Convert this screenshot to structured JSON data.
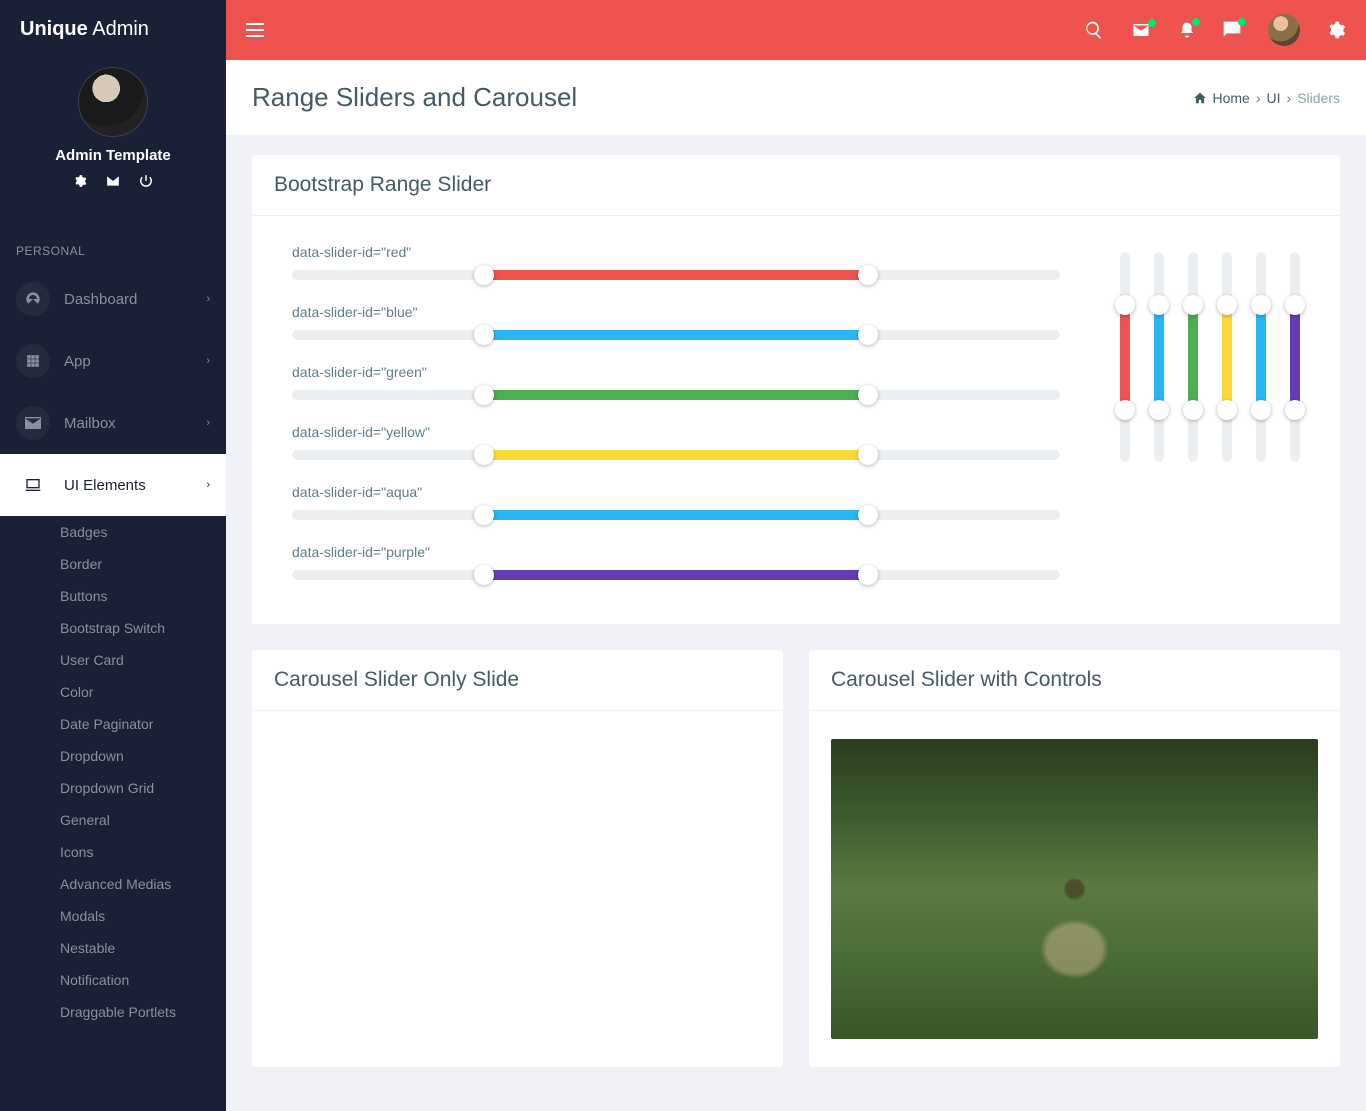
{
  "brand": {
    "bold": "Unique",
    "light": "Admin"
  },
  "user": {
    "name": "Admin Template"
  },
  "sidebar": {
    "section": "PERSONAL",
    "items": [
      {
        "label": "Dashboard",
        "icon": "dashboard-icon"
      },
      {
        "label": "App",
        "icon": "grid-icon"
      },
      {
        "label": "Mailbox",
        "icon": "mail-icon"
      },
      {
        "label": "UI Elements",
        "icon": "laptop-icon",
        "active": true
      }
    ],
    "subitems": [
      "Badges",
      "Border",
      "Buttons",
      "Bootstrap Switch",
      "User Card",
      "Color",
      "Date Paginator",
      "Dropdown",
      "Dropdown Grid",
      "General",
      "Icons",
      "Advanced Medias",
      "Modals",
      "Nestable",
      "Notification",
      "Draggable Portlets"
    ]
  },
  "page": {
    "title": "Range Sliders and Carousel",
    "breadcrumb": {
      "home": "Home",
      "mid": "UI",
      "current": "Sliders"
    }
  },
  "panels": {
    "range": {
      "title": "Bootstrap Range Slider",
      "sliders": [
        {
          "label": "data-slider-id=\"red\"",
          "color": "c-red"
        },
        {
          "label": "data-slider-id=\"blue\"",
          "color": "c-blue"
        },
        {
          "label": "data-slider-id=\"green\"",
          "color": "c-green"
        },
        {
          "label": "data-slider-id=\"yellow\"",
          "color": "c-yellow"
        },
        {
          "label": "data-slider-id=\"aqua\"",
          "color": "c-aqua"
        },
        {
          "label": "data-slider-id=\"purple\"",
          "color": "c-purple"
        }
      ],
      "vertical_colors": [
        "c-red",
        "c-blue",
        "c-green",
        "c-yellow",
        "c-aqua",
        "c-purple"
      ]
    },
    "carousel1": {
      "title": "Carousel Slider Only Slide"
    },
    "carousel2": {
      "title": "Carousel Slider with Controls"
    }
  }
}
